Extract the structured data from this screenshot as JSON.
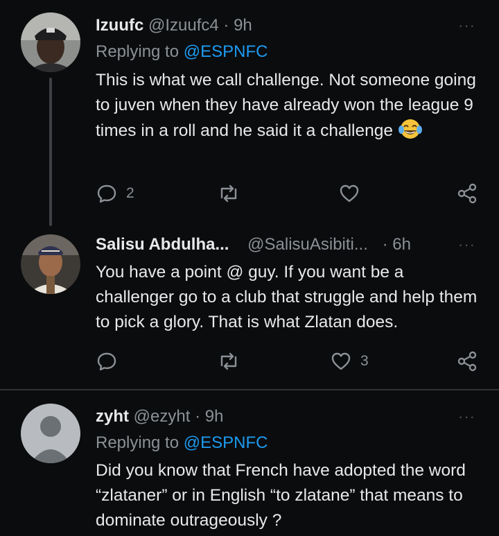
{
  "tweets": [
    {
      "name": "Izuufc",
      "handle": "@Izuufc4",
      "time": "· 9h",
      "replying_prefix": "Replying to",
      "replying_to": "@ESPNFC",
      "text": "This is what we call challenge. Not someone going to juven when they have already won the league 9 times in a roll and he said it a challenge",
      "replies": "2",
      "retweets": "",
      "likes": ""
    },
    {
      "name": "Salisu Abdulha...",
      "handle": "@SalisuAsibiti...",
      "time": "· 6h",
      "text": "You have a point @ guy. If you want be a challenger go to a club that struggle and help them to pick a glory. That is what Zlatan does.",
      "replies": "",
      "retweets": "",
      "likes": "3"
    },
    {
      "name": "zyht",
      "handle": "@ezyht",
      "time": "· 9h",
      "replying_prefix": "Replying to",
      "replying_to": "@ESPNFC",
      "text": "Did you know that French have adopted the word “zlataner” or in English “to zlatane” that means to dominate outrageously ?"
    }
  ],
  "more_icon": "more-dots-icon",
  "colors": {
    "background": "#0b0c0e",
    "text": "#e7e9ea",
    "muted": "#8b9196",
    "link": "#1d9bf0",
    "divider": "#2f3336"
  }
}
